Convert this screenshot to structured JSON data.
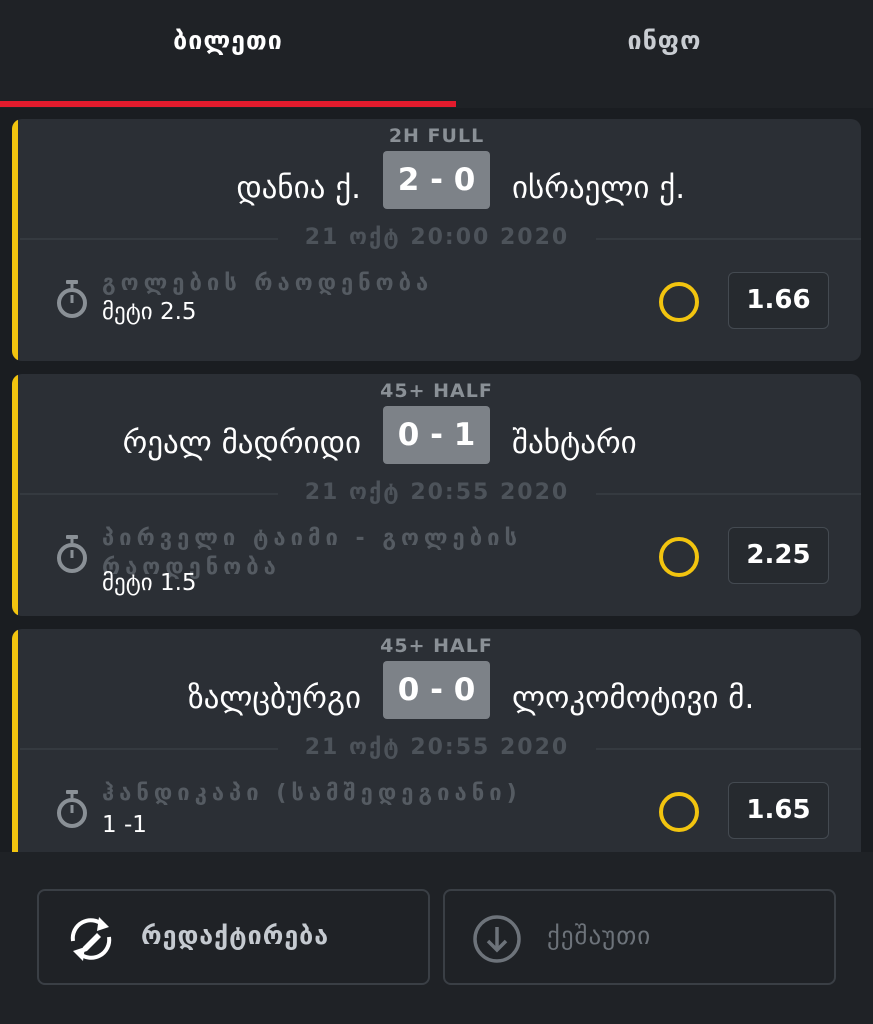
{
  "tabs": {
    "ticket": "ბილეთი",
    "info": "ინფო"
  },
  "bets": [
    {
      "status": "2H FULL",
      "home": "დანია ქ.",
      "score": "2 - 0",
      "away": "ისრაელი ქ.",
      "date": "21 ოქტ 20:00 2020",
      "market": "გოლების რაოდენობა",
      "selection": "მეტი 2.5",
      "odds": "1.66"
    },
    {
      "status": "45+ HALF",
      "home": "რეალ მადრიდი",
      "score": "0 - 1",
      "away": "შახტარი",
      "date": "21 ოქტ 20:55 2020",
      "market": "პირველი ტაიმი - გოლების რაოდენობა",
      "selection": "მეტი 1.5",
      "odds": "2.25"
    },
    {
      "status": "45+ HALF",
      "home": "ზალცბურგი",
      "score": "0 - 0",
      "away": "ლოკომოტივი მ.",
      "date": "21 ოქტ 20:55 2020",
      "market": "ჰანდიკაპი (სამშედეგიანი)",
      "selection": "1 -1",
      "odds": "1.65"
    }
  ],
  "actions": {
    "edit": "რედაქტირება",
    "save": "ქეშაუთი"
  },
  "icons": {
    "timer": "stopwatch-icon",
    "result": "pending-circle-icon",
    "edit": "edit-refresh-icon",
    "save": "download-circle-icon"
  },
  "colors": {
    "accent": "#f2c40f",
    "active_tab": "#e31b2d",
    "card_bg": "#2b2f35",
    "score_bg": "#7d8288"
  }
}
